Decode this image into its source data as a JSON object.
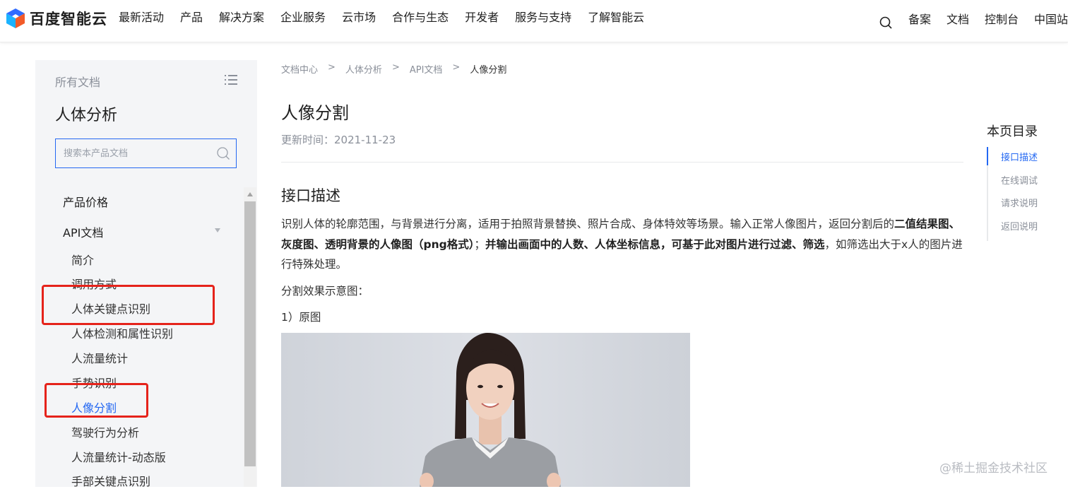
{
  "brand": {
    "name": "百度智能云"
  },
  "nav": {
    "items": [
      "最新活动",
      "产品",
      "解决方案",
      "企业服务",
      "云市场",
      "合作与生态",
      "开发者",
      "服务与支持",
      "了解智能云"
    ],
    "right": [
      "备案",
      "文档",
      "控制台",
      "中国站"
    ]
  },
  "sidebar": {
    "all_docs": "所有文档",
    "product": "人体分析",
    "search_placeholder": "搜索本产品文档",
    "top_items": [
      "产品价格",
      "API文档"
    ],
    "sub_items": [
      "简介",
      "调用方式",
      "人体关键点识别",
      "人体检测和属性识别",
      "人流量统计",
      "手势识别",
      "人像分割",
      "驾驶行为分析",
      "人流量统计-动态版",
      "手部关键点识别"
    ],
    "active": "人像分割"
  },
  "breadcrumb": [
    "文档中心",
    "人体分析",
    "API文档",
    "人像分割"
  ],
  "breadcrumb_sep": ">",
  "page": {
    "title": "人像分割",
    "updated": "更新时间：2021-11-23",
    "section": "接口描述",
    "desc_1": "识别人体的轮廓范围，与背景进行分离，适用于拍照背景替换、照片合成、身体特效等场景。输入正常人像图片，返回分割后的",
    "desc_b1": "二值结果图、灰度图、透明背景的人像图（png格式）",
    "desc_2": "；",
    "desc_b2": "并输出画面中的人数、人体坐标信息，可基于此对图片进行过滤、筛选",
    "desc_3": "，如筛选出大于x人的图片进行特殊处理。",
    "example_label": "分割效果示意图：",
    "original_label": "1）原图"
  },
  "toc": {
    "title": "本页目录",
    "items": [
      "接口描述",
      "在线调试",
      "请求说明",
      "返回说明"
    ],
    "active": "接口描述"
  },
  "watermark": "@稀土掘金技术社区",
  "colors": {
    "accent": "#2468f2",
    "highlight_box": "#e5231b"
  }
}
